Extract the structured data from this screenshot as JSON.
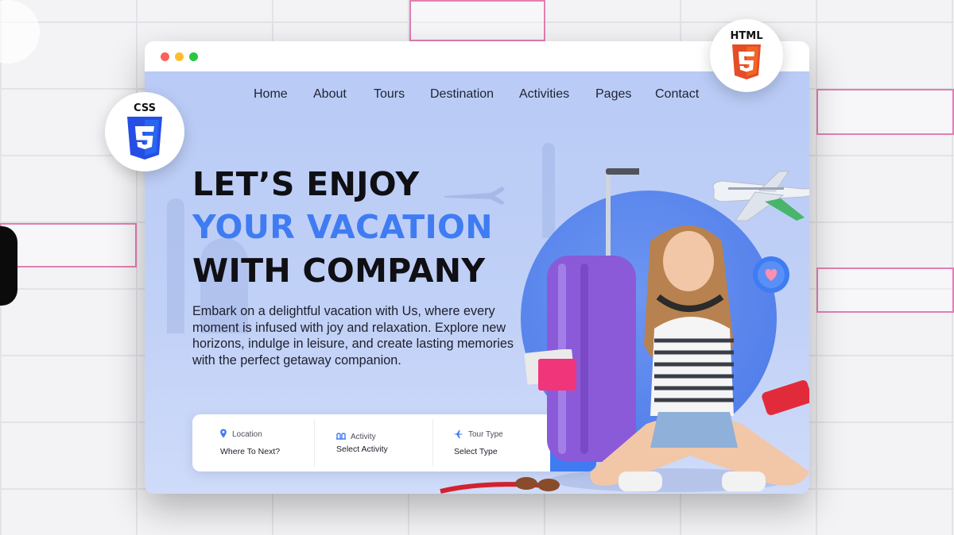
{
  "nav": {
    "items": [
      {
        "label": "Home"
      },
      {
        "label": "About"
      },
      {
        "label": "Tours"
      },
      {
        "label": "Destination"
      },
      {
        "label": "Activities"
      },
      {
        "label": "Pages"
      },
      {
        "label": "Contact"
      }
    ]
  },
  "hero": {
    "line1": "LET’S ENJOY",
    "line2": "YOUR VACATION",
    "line3": "WITH COMPANY",
    "description": "Embark on a delightful vacation with Us, where every moment is infused with joy and relaxation. Explore new horizons, indulge in leisure, and create lasting memories with the perfect getaway companion."
  },
  "search": {
    "location_label": "Location",
    "location_value": "Where To Next?",
    "activity_label": "Activity",
    "activity_value": "Select Activity",
    "tour_label": "Tour Type",
    "tour_value": "Select Type",
    "button_icon": "search-icon"
  },
  "badges": {
    "css": "CSS",
    "css_icon": "css3-logo-icon",
    "html": "HTML",
    "html_icon": "html5-logo-icon"
  },
  "colors": {
    "accent": "#3f7cf2",
    "hero_bg": "#bccdf6",
    "css_blue": "#264de4",
    "html_orange": "#e44d26",
    "suitcase": "#8a5ad8"
  },
  "window_controls": [
    "close",
    "minimize",
    "maximize"
  ]
}
